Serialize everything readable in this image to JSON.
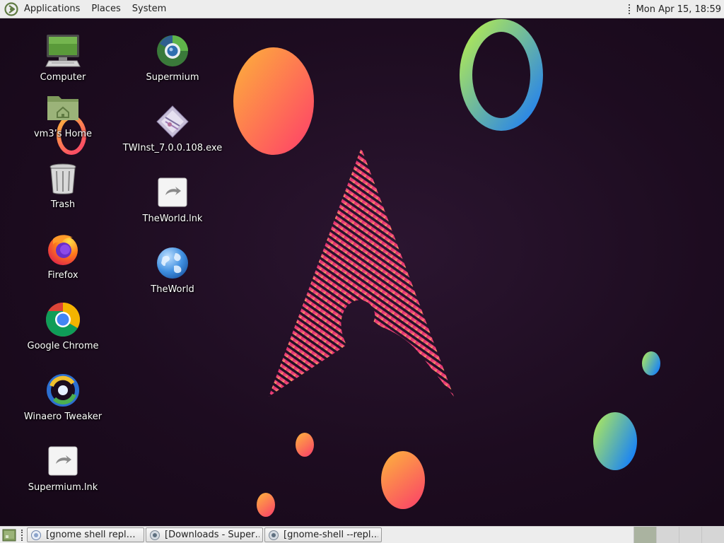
{
  "top_panel": {
    "menus": [
      {
        "label": "Applications"
      },
      {
        "label": "Places"
      },
      {
        "label": "System"
      }
    ],
    "clock": "Mon Apr 15, 18:59"
  },
  "desktop": {
    "icons": [
      {
        "label": "Computer",
        "icon": "computer-icon"
      },
      {
        "label": "vm3’s Home",
        "icon": "home-folder-icon"
      },
      {
        "label": "Trash",
        "icon": "trash-icon"
      },
      {
        "label": "Firefox",
        "icon": "firefox-icon"
      },
      {
        "label": "Google Chrome",
        "icon": "chrome-icon"
      },
      {
        "label": "Winaero Tweaker",
        "icon": "winaero-tweaker-icon"
      },
      {
        "label": "Supermium.lnk",
        "icon": "shortcut-icon"
      },
      {
        "label": "Supermium",
        "icon": "supermium-icon"
      },
      {
        "label": "TWInst_7.0.0.108.exe",
        "icon": "exe-installer-icon"
      },
      {
        "label": "TheWorld.lnk",
        "icon": "shortcut-icon"
      },
      {
        "label": "TheWorld",
        "icon": "theworld-globe-icon"
      }
    ],
    "wallpaper": "arch-linux-logo-with-gradient-bubbles"
  },
  "bottom_panel": {
    "tasks": [
      {
        "label": "[gnome shell repl…",
        "icon": "app-icon"
      },
      {
        "label": "[Downloads - Super…",
        "icon": "browser-icon"
      },
      {
        "label": "[gnome-shell --repl…",
        "icon": "browser-icon"
      }
    ],
    "workspaces": [
      "1",
      "2",
      "3",
      "4"
    ]
  },
  "colors": {
    "panel_bg": "#ededed",
    "desktop_bg": "#1d0c20",
    "arch_pink": "#e8307a",
    "arch_yellow": "#f6c340",
    "bubble_orange": "#fb8a38",
    "bubble_green": "#9be15d",
    "bubble_blue": "#1f8ff0"
  }
}
